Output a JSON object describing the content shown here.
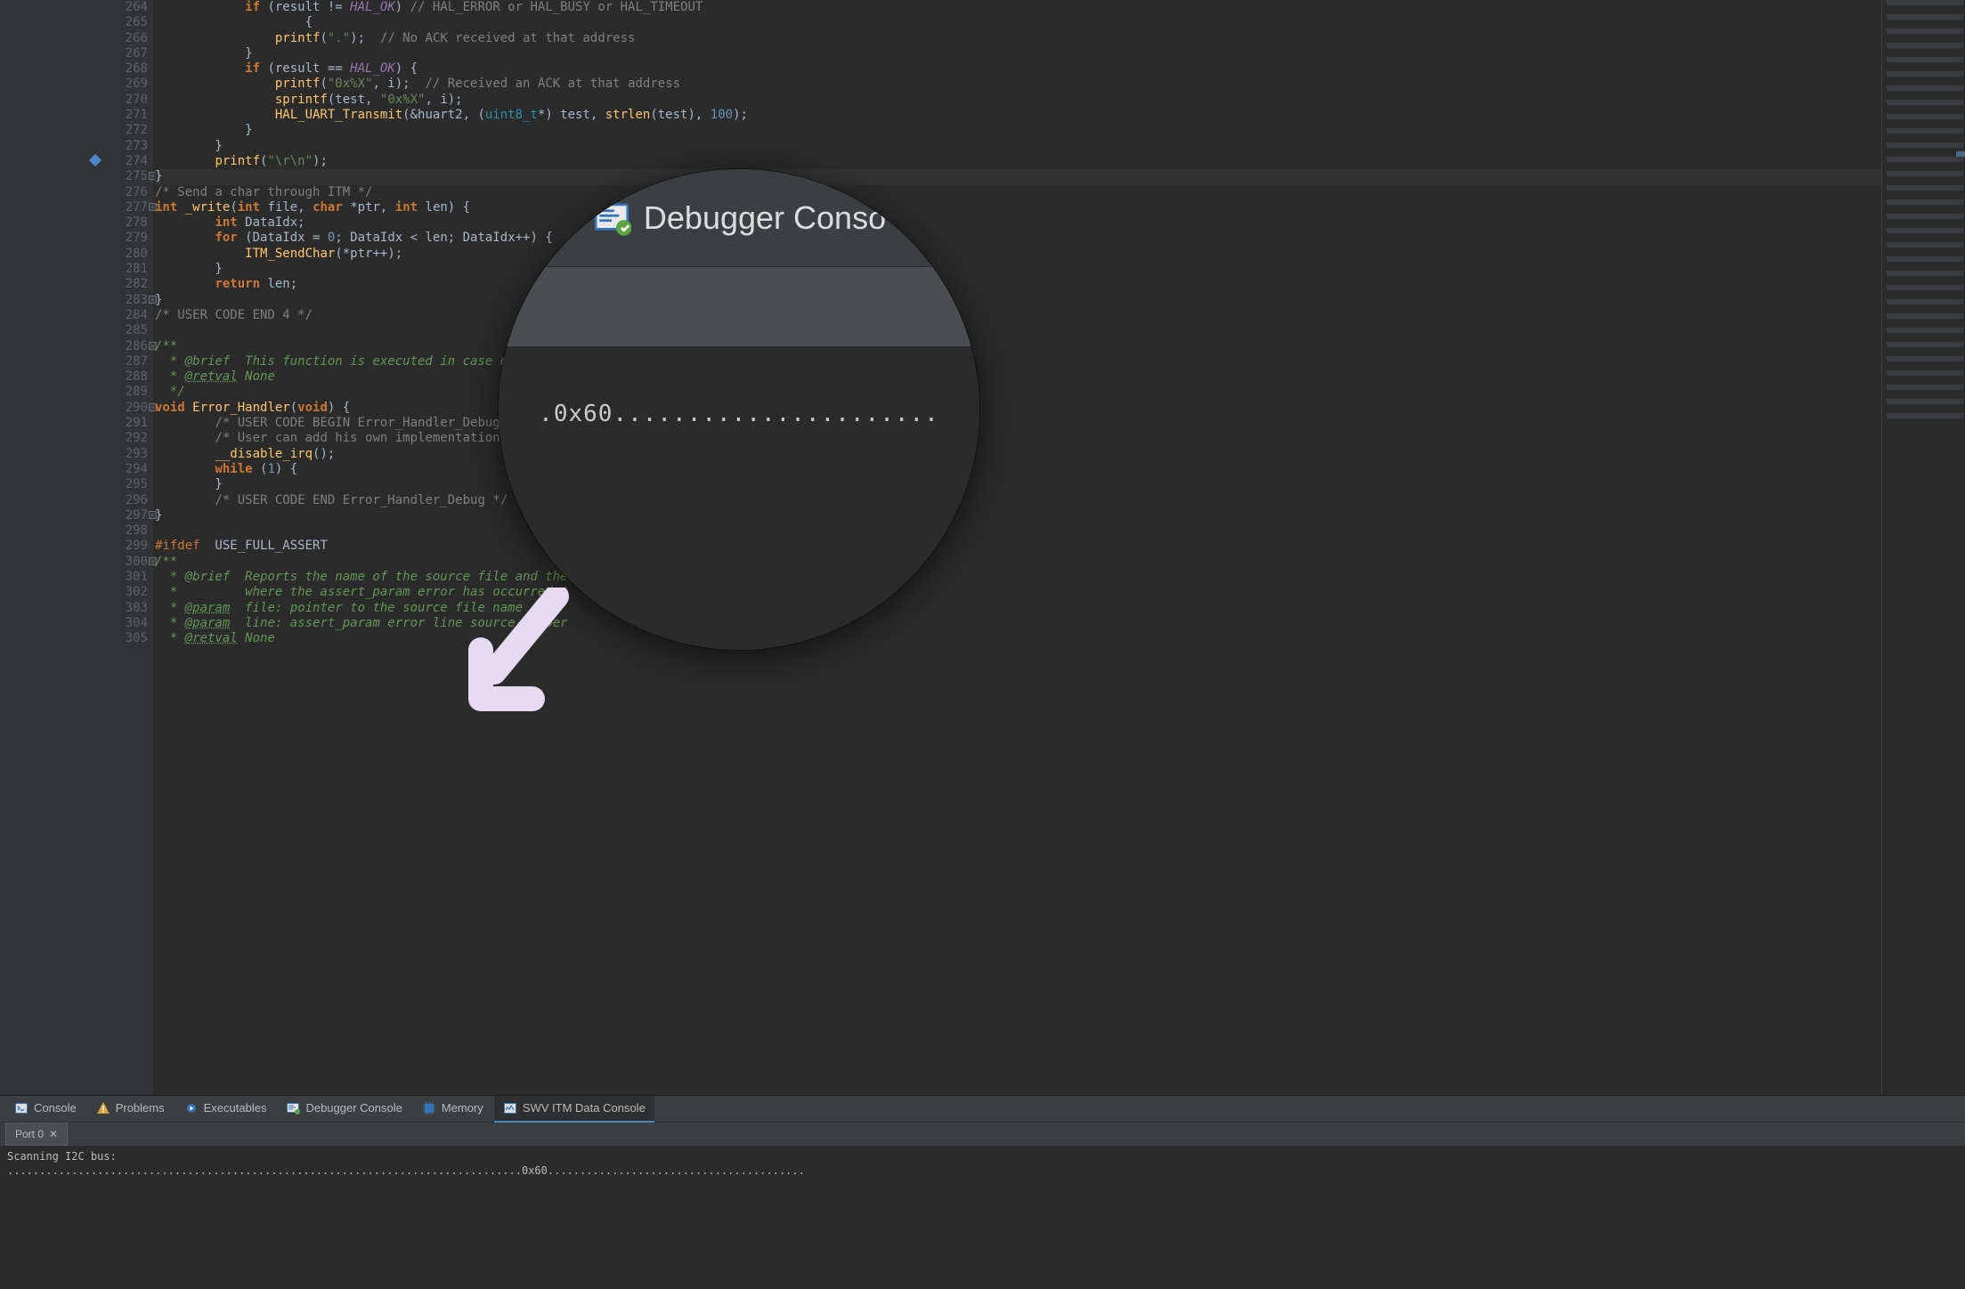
{
  "editor": {
    "first_line_number": 264,
    "lines": [
      {
        "n": 264,
        "tokens": [
          [
            "            ",
            ""
          ],
          [
            "if",
            "kw"
          ],
          [
            " (result != ",
            "id"
          ],
          [
            "HAL_OK",
            "mac"
          ],
          [
            ") ",
            "id"
          ],
          [
            "// HAL_ERROR or HAL_BUSY or HAL_TIMEOUT",
            "cmt"
          ]
        ]
      },
      {
        "n": 265,
        "tokens": [
          [
            "                    {",
            "id"
          ]
        ]
      },
      {
        "n": 266,
        "tokens": [
          [
            "                ",
            ""
          ],
          [
            "printf",
            "fn"
          ],
          [
            "(",
            "id"
          ],
          [
            "\".\"",
            "str"
          ],
          [
            ");  ",
            "id"
          ],
          [
            "// No ACK received at that address",
            "cmt"
          ]
        ]
      },
      {
        "n": 267,
        "tokens": [
          [
            "            }",
            "id"
          ]
        ]
      },
      {
        "n": 268,
        "tokens": [
          [
            "            ",
            ""
          ],
          [
            "if",
            "kw"
          ],
          [
            " (result == ",
            "id"
          ],
          [
            "HAL_OK",
            "mac"
          ],
          [
            ") {",
            "id"
          ]
        ]
      },
      {
        "n": 269,
        "tokens": [
          [
            "                ",
            ""
          ],
          [
            "printf",
            "fn"
          ],
          [
            "(",
            "id"
          ],
          [
            "\"0x%X\"",
            "str"
          ],
          [
            ", i);  ",
            "id"
          ],
          [
            "// Received an ACK at that address",
            "cmt"
          ]
        ]
      },
      {
        "n": 270,
        "tokens": [
          [
            "                ",
            ""
          ],
          [
            "sprintf",
            "fn"
          ],
          [
            "(test, ",
            "id"
          ],
          [
            "\"0x%X\"",
            "str"
          ],
          [
            ", i);",
            "id"
          ]
        ]
      },
      {
        "n": 271,
        "tokens": [
          [
            "                ",
            ""
          ],
          [
            "HAL_UART_Transmit",
            "fn"
          ],
          [
            "(&huart2, (",
            "id"
          ],
          [
            "uint8_t",
            "type"
          ],
          [
            "*) test, ",
            "id"
          ],
          [
            "strlen",
            "fn"
          ],
          [
            "(test), ",
            "id"
          ],
          [
            "100",
            "num"
          ],
          [
            ");",
            "id"
          ]
        ]
      },
      {
        "n": 272,
        "tokens": [
          [
            "            }",
            "id"
          ]
        ]
      },
      {
        "n": 273,
        "tokens": [
          [
            "        }",
            "id"
          ]
        ]
      },
      {
        "n": 274,
        "mark": true,
        "tokens": [
          [
            "        ",
            ""
          ],
          [
            "printf",
            "fn"
          ],
          [
            "(",
            "id"
          ],
          [
            "\"\\r\\n\"",
            "str"
          ],
          [
            ");",
            "id"
          ]
        ]
      },
      {
        "n": 275,
        "hl": true,
        "fold": true,
        "tokens": [
          [
            "}",
            "id"
          ]
        ]
      },
      {
        "n": 276,
        "tokens": [
          [
            "/* Send a char through ITM */",
            "cmt"
          ]
        ]
      },
      {
        "n": 277,
        "fold": true,
        "tokens": [
          [
            "int",
            "kw"
          ],
          [
            " ",
            "id"
          ],
          [
            "_write",
            "fn"
          ],
          [
            "(",
            "id"
          ],
          [
            "int",
            "kw"
          ],
          [
            " file, ",
            "id"
          ],
          [
            "char",
            "kw"
          ],
          [
            " *ptr, ",
            "id"
          ],
          [
            "int",
            "kw"
          ],
          [
            " len) {",
            "id"
          ]
        ]
      },
      {
        "n": 278,
        "tokens": [
          [
            "        ",
            ""
          ],
          [
            "int",
            "kw"
          ],
          [
            " DataIdx;",
            "id"
          ]
        ]
      },
      {
        "n": 279,
        "tokens": [
          [
            "        ",
            ""
          ],
          [
            "for",
            "kw"
          ],
          [
            " (DataIdx = ",
            "id"
          ],
          [
            "0",
            "num"
          ],
          [
            "; DataIdx < len; DataIdx++) {",
            "id"
          ]
        ]
      },
      {
        "n": 280,
        "tokens": [
          [
            "            ",
            ""
          ],
          [
            "ITM_SendChar",
            "fn"
          ],
          [
            "(*ptr++);",
            "id"
          ]
        ]
      },
      {
        "n": 281,
        "tokens": [
          [
            "        }",
            "id"
          ]
        ]
      },
      {
        "n": 282,
        "tokens": [
          [
            "        ",
            ""
          ],
          [
            "return",
            "kw"
          ],
          [
            " len;",
            "id"
          ]
        ]
      },
      {
        "n": 283,
        "fold": true,
        "tokens": [
          [
            "}",
            "id"
          ]
        ]
      },
      {
        "n": 284,
        "tokens": [
          [
            "/* USER CODE END 4 */",
            "cmt"
          ]
        ]
      },
      {
        "n": 285,
        "tokens": [
          [
            "",
            ""
          ]
        ]
      },
      {
        "n": 286,
        "fold": true,
        "tokens": [
          [
            "/**",
            "doc"
          ]
        ]
      },
      {
        "n": 287,
        "tokens": [
          [
            "  * @brief  This function is executed in case of error occurrence.",
            "doc"
          ]
        ]
      },
      {
        "n": 288,
        "tokens": [
          [
            "  * ",
            "doc"
          ],
          [
            "@retval",
            "doctag"
          ],
          [
            " None",
            "doc"
          ]
        ]
      },
      {
        "n": 289,
        "tokens": [
          [
            "  */",
            "doc"
          ]
        ]
      },
      {
        "n": 290,
        "fold": true,
        "tokens": [
          [
            "void",
            "kw"
          ],
          [
            " ",
            "id"
          ],
          [
            "Error_Handler",
            "fn"
          ],
          [
            "(",
            "id"
          ],
          [
            "void",
            "kw"
          ],
          [
            ") {",
            "id"
          ]
        ]
      },
      {
        "n": 291,
        "tokens": [
          [
            "        ",
            ""
          ],
          [
            "/* USER CODE BEGIN Error_Handler_Debug */",
            "cmt"
          ]
        ]
      },
      {
        "n": 292,
        "tokens": [
          [
            "        ",
            ""
          ],
          [
            "/* User can add his own implementation to report the HAL error return state */",
            "cmt"
          ]
        ]
      },
      {
        "n": 293,
        "tokens": [
          [
            "        ",
            ""
          ],
          [
            "__disable_irq",
            "fn"
          ],
          [
            "();",
            "id"
          ]
        ]
      },
      {
        "n": 294,
        "tokens": [
          [
            "        ",
            ""
          ],
          [
            "while",
            "kw"
          ],
          [
            " (",
            "id"
          ],
          [
            "1",
            "num"
          ],
          [
            ") {",
            "id"
          ]
        ]
      },
      {
        "n": 295,
        "tokens": [
          [
            "        }",
            "id"
          ]
        ]
      },
      {
        "n": 296,
        "tokens": [
          [
            "        ",
            ""
          ],
          [
            "/* USER CODE END Error_Handler_Debug */",
            "cmt"
          ]
        ]
      },
      {
        "n": 297,
        "fold": true,
        "tokens": [
          [
            "}",
            "id"
          ]
        ]
      },
      {
        "n": 298,
        "tokens": [
          [
            "",
            ""
          ]
        ]
      },
      {
        "n": 299,
        "tokens": [
          [
            "#ifdef",
            "pp"
          ],
          [
            "  USE_FULL_ASSERT",
            "def"
          ]
        ]
      },
      {
        "n": 300,
        "fold": true,
        "tokens": [
          [
            "/**",
            "doc"
          ]
        ]
      },
      {
        "n": 301,
        "tokens": [
          [
            "  * @brief  Reports the name of the source file and the source line number",
            "doc"
          ]
        ]
      },
      {
        "n": 302,
        "tokens": [
          [
            "  *         where the assert_param error has occurred.",
            "doc"
          ]
        ]
      },
      {
        "n": 303,
        "tokens": [
          [
            "  * ",
            "doc"
          ],
          [
            "@param",
            "doctag"
          ],
          [
            "  file: pointer to the source file name",
            "doc"
          ]
        ]
      },
      {
        "n": 304,
        "tokens": [
          [
            "  * ",
            "doc"
          ],
          [
            "@param",
            "doctag"
          ],
          [
            "  line: assert_param error line source number",
            "doc"
          ]
        ]
      },
      {
        "n": 305,
        "tokens": [
          [
            "  * ",
            "doc"
          ],
          [
            "@retval",
            "doctag"
          ],
          [
            " None",
            "doc"
          ]
        ]
      }
    ]
  },
  "panel": {
    "tabs": [
      {
        "id": "console",
        "label": "Console",
        "icon": "terminal-icon"
      },
      {
        "id": "problems",
        "label": "Problems",
        "icon": "warning-icon"
      },
      {
        "id": "executables",
        "label": "Executables",
        "icon": "gear-run-icon"
      },
      {
        "id": "debugger-console",
        "label": "Debugger Console",
        "icon": "debug-console-icon"
      },
      {
        "id": "memory",
        "label": "Memory",
        "icon": "memory-icon"
      },
      {
        "id": "swv",
        "label": "SWV ITM Data Console",
        "icon": "swv-icon",
        "active": true
      }
    ],
    "subtab": {
      "label": "Port 0"
    },
    "output_lines": [
      "Scanning I2C bus:",
      "................................................................................0x60........................................"
    ]
  },
  "magnifier": {
    "tab_label": "Debugger Conso",
    "body_text": ".0x60......................"
  },
  "icons": {
    "terminal-icon": "#4a88c7",
    "warning-icon": "#d9a33c",
    "gear-run-icon": "#4a88c7",
    "debug-console-icon": "#4a88c7",
    "memory-icon": "#4a88c7",
    "swv-icon": "#4a88c7"
  }
}
